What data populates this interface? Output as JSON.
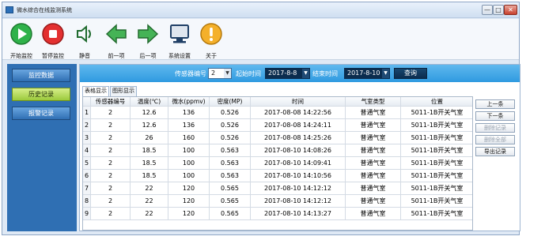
{
  "window": {
    "title": "微水综合在线监测系统",
    "controls": [
      "—",
      "□",
      "✕"
    ]
  },
  "toolbar": {
    "items": [
      {
        "label": "开始监控",
        "icon": "play-icon",
        "color": "#27a83a"
      },
      {
        "label": "暂停监控",
        "icon": "stop-icon",
        "color": "#e12b2b"
      },
      {
        "label": "静音",
        "icon": "speaker-icon",
        "color": "#2a8a3a"
      },
      {
        "label": "前一项",
        "icon": "arrow-left-icon",
        "color": "#3aa64a"
      },
      {
        "label": "后一项",
        "icon": "arrow-right-icon",
        "color": "#3aa64a"
      },
      {
        "label": "系统设置",
        "icon": "monitor-icon",
        "color": "#1f3f66"
      },
      {
        "label": "关于",
        "icon": "warning-icon",
        "color": "#f0a020"
      }
    ]
  },
  "sidebar": {
    "items": [
      {
        "label": "监控数据",
        "active": false
      },
      {
        "label": "历史记录",
        "active": true
      },
      {
        "label": "报警记录",
        "active": false
      }
    ]
  },
  "query": {
    "sensor_label": "传感器编号",
    "sensor_value": "2",
    "start_label": "起始时间",
    "start_value": "2017-8-8",
    "end_label": "结束时间",
    "end_value": "2017-8-10",
    "query_button": "查询"
  },
  "tabs": [
    {
      "label": "表格显示",
      "active": true
    },
    {
      "label": "图形显示",
      "active": false
    }
  ],
  "table": {
    "columns": [
      "传感器编号",
      "温度(℃)",
      "微水(ppmv)",
      "密度(MP)",
      "时间",
      "气室类型",
      "位置"
    ],
    "rows": [
      [
        "1",
        "2",
        "12.6",
        "136",
        "0.526",
        "2017-08-08 14:22:56",
        "普通气室",
        "5011-1B开关气室"
      ],
      [
        "2",
        "2",
        "12.6",
        "136",
        "0.526",
        "2017-08-08 14:24:11",
        "普通气室",
        "5011-1B开关气室"
      ],
      [
        "3",
        "2",
        "26",
        "160",
        "0.526",
        "2017-08-08 14:25:26",
        "普通气室",
        "5011-1B开关气室"
      ],
      [
        "4",
        "2",
        "18.5",
        "100",
        "0.563",
        "2017-08-10 14:08:26",
        "普通气室",
        "5011-1B开关气室"
      ],
      [
        "5",
        "2",
        "18.5",
        "100",
        "0.563",
        "2017-08-10 14:09:41",
        "普通气室",
        "5011-1B开关气室"
      ],
      [
        "6",
        "2",
        "18.5",
        "100",
        "0.563",
        "2017-08-10 14:10:56",
        "普通气室",
        "5011-1B开关气室"
      ],
      [
        "7",
        "2",
        "22",
        "120",
        "0.565",
        "2017-08-10 14:12:12",
        "普通气室",
        "5011-1B开关气室"
      ],
      [
        "8",
        "2",
        "22",
        "120",
        "0.565",
        "2017-08-10 14:12:12",
        "普通气室",
        "5011-1B开关气室"
      ],
      [
        "9",
        "2",
        "22",
        "120",
        "0.565",
        "2017-08-10 14:13:27",
        "普通气室",
        "5011-1B开关气室"
      ]
    ]
  },
  "side_buttons": [
    {
      "label": "上一条",
      "enabled": true
    },
    {
      "label": "下一条",
      "enabled": true
    },
    {
      "label": "删除记录",
      "enabled": false
    },
    {
      "label": "删除全部",
      "enabled": false
    },
    {
      "label": "导出记录",
      "enabled": true
    }
  ]
}
